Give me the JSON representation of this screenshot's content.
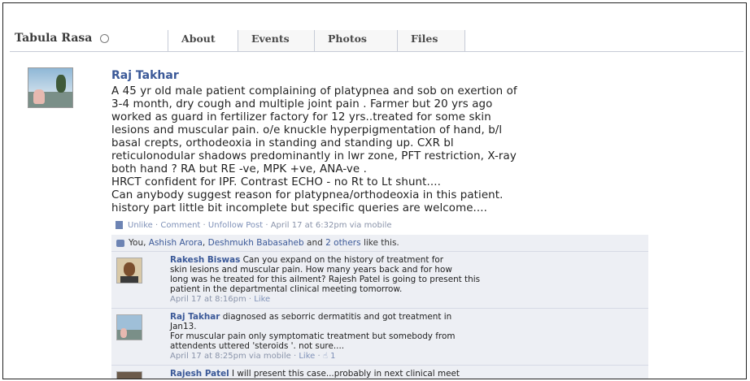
{
  "tabs": {
    "group_name": "Tabula Rasa",
    "items": [
      "About",
      "Events",
      "Photos",
      "Files"
    ]
  },
  "post": {
    "author": "Raj Takhar",
    "lines": [
      "A 45 yr old male patient complaining of platypnea and sob on exertion of",
      "3-4 month, dry cough and multiple joint pain . Farmer but 20 yrs ago",
      "worked as guard in fertilizer factory for 12 yrs..treated for some skin",
      "lesions and muscular pain. o/e knuckle hyperpigmentation of hand, b/l",
      "basal crepts, orthodeoxia in standing and standing up. CXR bl",
      "reticulonodular shadows predominantly in lwr zone, PFT restriction, X-ray",
      "both hand ? RA but RE -ve, MPK +ve, ANA-ve .",
      "HRCT confident for IPF. Contrast ECHO - no Rt to Lt shunt....",
      "Can anybody suggest reason for platypnea/orthodeoxia in this patient.",
      "history part little bit incomplete but specific queries are welcome...."
    ],
    "actions": {
      "unlike": "Unlike",
      "comment": "Comment",
      "unfollow": "Unfollow Post",
      "timestamp": "April 17 at 6:32pm via mobile"
    }
  },
  "likes": {
    "prefix": "You,",
    "name1": "Ashish Arora",
    "name2": "Deshmukh Babasaheb",
    "and": "and",
    "others": "2 others",
    "suffix": "like this."
  },
  "comments": [
    {
      "author": "Rakesh Biswas",
      "lines": [
        " Can you expand on the history of treatment for",
        "skin lesions and muscular pain. How many years back and for how",
        "long was he treated for this ailment? Rajesh Patel is going to present this",
        "patient in the departmental clinical meeting tomorrow."
      ],
      "time": "April 17 at 8:16pm",
      "action": "Like"
    },
    {
      "author": "Raj Takhar",
      "lines": [
        " diagnosed as seborric dermatitis and got treatment in",
        "Jan13.",
        "For muscular pain only symptomatic treatment but somebody from",
        "attendents uttered 'steroids '. not sure...."
      ],
      "time": "April 17 at 8:25pm via mobile",
      "action": "Like",
      "likes": "1"
    },
    {
      "author": "Rajesh Patel",
      "lines": [
        " I will present this case...probably in next clinical meet"
      ]
    }
  ]
}
